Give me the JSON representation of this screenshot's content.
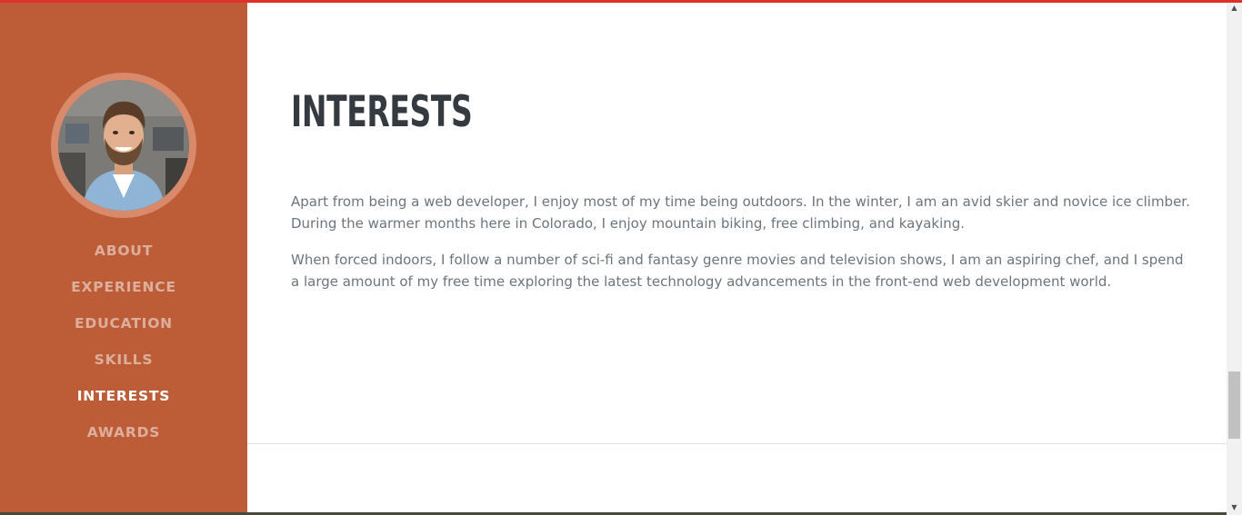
{
  "sidebar": {
    "avatar_alt": "profile photo",
    "nav": [
      {
        "label": "ABOUT",
        "active": false
      },
      {
        "label": "EXPERIENCE",
        "active": false
      },
      {
        "label": "EDUCATION",
        "active": false
      },
      {
        "label": "SKILLS",
        "active": false
      },
      {
        "label": "INTERESTS",
        "active": true
      },
      {
        "label": "AWARDS",
        "active": false
      }
    ]
  },
  "main": {
    "title": "INTERESTS",
    "paragraphs": [
      "Apart from being a web developer, I enjoy most of my time being outdoors. In the winter, I am an avid skier and novice ice climber. During the warmer months here in Colorado, I enjoy mountain biking, free climbing, and kayaking.",
      "When forced indoors, I follow a number of sci-fi and fantasy genre movies and television shows, I am an aspiring chef, and I spend a large amount of my free time exploring the latest technology advancements in the front-end web development world."
    ]
  },
  "scrollbar": {
    "up_arrow": "▲",
    "down_arrow": "▼"
  },
  "colors": {
    "sidebar": "#bd5d38",
    "accent_top": "#e0302a",
    "title": "#343a40",
    "body_text": "#6c757d"
  }
}
